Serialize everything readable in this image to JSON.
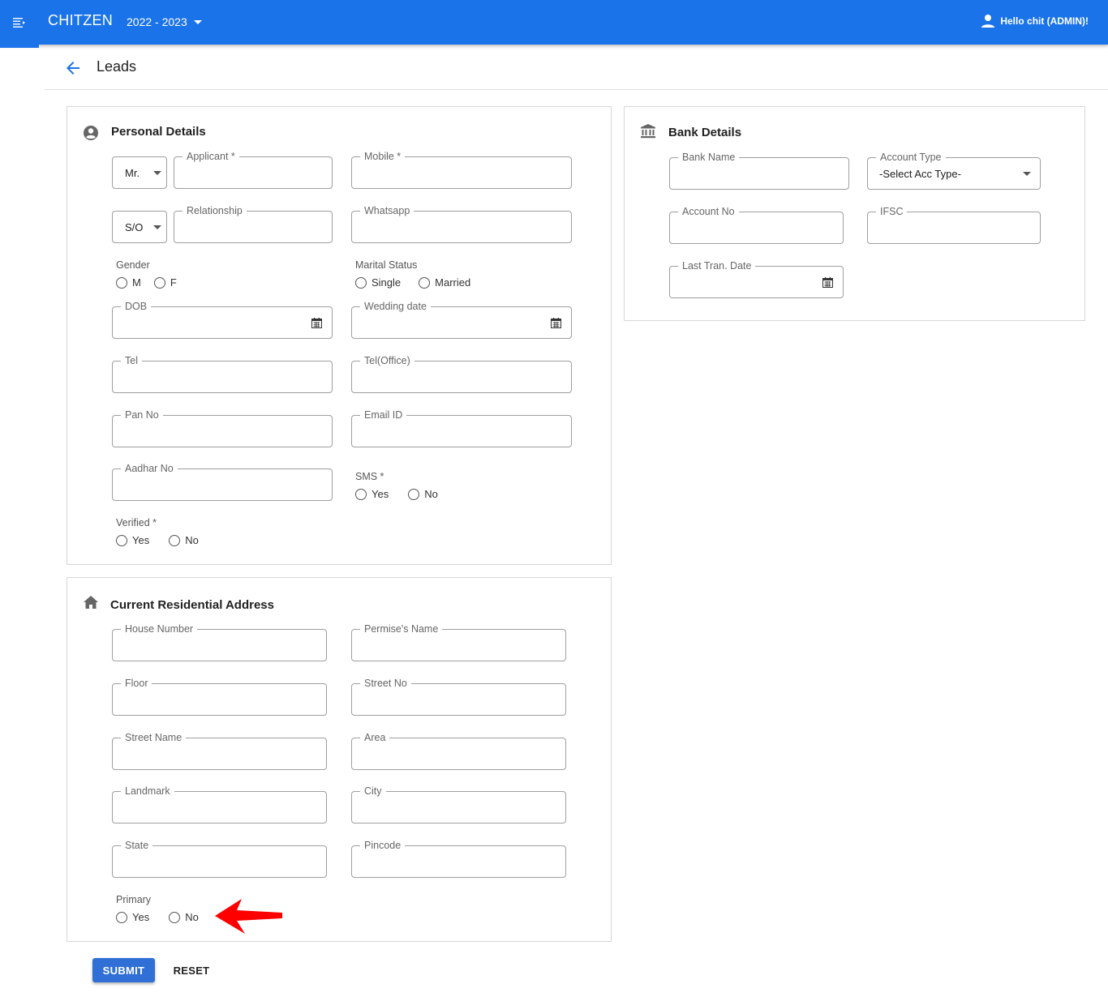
{
  "app": {
    "brand": "CHITZEN",
    "year": "2022 - 2023",
    "user_greeting": "Hello chit (ADMIN)!"
  },
  "page": {
    "title": "Leads"
  },
  "personal": {
    "title": "Personal Details",
    "title_select": "Mr.",
    "applicant_label": "Applicant *",
    "mobile_label": "Mobile *",
    "relation_select": "S/O",
    "relationship_label": "Relationship",
    "whatsapp_label": "Whatsapp",
    "gender": {
      "label": "Gender",
      "options": [
        "M",
        "F"
      ]
    },
    "marital": {
      "label": "Marital Status",
      "options": [
        "Single",
        "Married"
      ]
    },
    "dob_label": "DOB",
    "wedding_label": "Wedding date",
    "tel_label": "Tel",
    "tel_office_label": "Tel(Office)",
    "pan_label": "Pan No",
    "email_label": "Email ID",
    "aadhar_label": "Aadhar No",
    "sms": {
      "label": "SMS *",
      "options": [
        "Yes",
        "No"
      ]
    },
    "verified": {
      "label": "Verified *",
      "options": [
        "Yes",
        "No"
      ]
    }
  },
  "bank": {
    "title": "Bank Details",
    "bank_name_label": "Bank Name",
    "account_type_label": "Account Type",
    "account_type_value": "-Select Acc Type-",
    "account_no_label": "Account No",
    "ifsc_label": "IFSC",
    "last_tran_label": "Last Tran. Date"
  },
  "address": {
    "title": "Current Residential Address",
    "house_label": "House Number",
    "premise_label": "Permise's Name",
    "floor_label": "Floor",
    "street_no_label": "Street No",
    "street_name_label": "Street Name",
    "area_label": "Area",
    "landmark_label": "Landmark",
    "city_label": "City",
    "state_label": "State",
    "pincode_label": "Pincode",
    "primary": {
      "label": "Primary",
      "options": [
        "Yes",
        "No"
      ]
    }
  },
  "actions": {
    "submit": "SUBMIT",
    "reset": "RESET"
  },
  "colors": {
    "primary": "#1a73e8",
    "button": "#2f6fd6",
    "annotation_arrow": "#ff0000"
  }
}
